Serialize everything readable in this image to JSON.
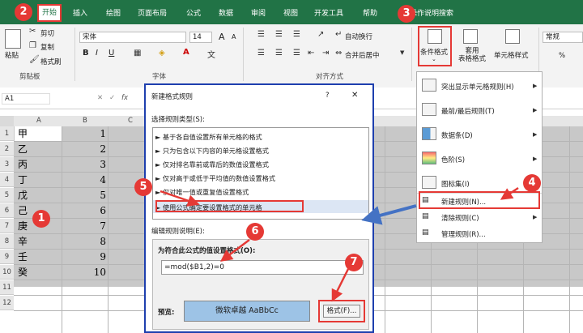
{
  "ribbon": {
    "tabs": [
      "插入",
      "绘图",
      "页面布局",
      "公式",
      "数据",
      "审阅",
      "视图",
      "开发工具",
      "帮助",
      "操作说明搜索"
    ],
    "home_tab": "开始",
    "clipboard": {
      "paste": "粘贴",
      "cut": "剪切",
      "copy": "复制",
      "format_painter": "格式刷",
      "label": "剪贴板"
    },
    "font": {
      "name": "宋体",
      "size": "14",
      "bold": "B",
      "italic": "I",
      "underline": "U",
      "grow": "A",
      "shrink": "A",
      "label": "字体"
    },
    "align": {
      "wrap": "自动换行",
      "merge": "合并后居中",
      "label": "对齐方式"
    },
    "cond_format": "条件格式",
    "table_format": "套用\n表格格式",
    "cell_style": "单元格样式",
    "number": {
      "format": "常规",
      "pct": "%"
    }
  },
  "formula_bar": {
    "name_box": "A1",
    "fx": "fx"
  },
  "grid": {
    "col_headers": [
      "A",
      "B",
      "C"
    ],
    "row_headers": [
      "1",
      "2",
      "3",
      "4",
      "5",
      "6",
      "7",
      "8",
      "9",
      "10",
      "11",
      "12"
    ],
    "col_a": [
      "甲",
      "乙",
      "丙",
      "丁",
      "戊",
      "己",
      "庚",
      "辛",
      "壬",
      "癸"
    ],
    "col_b": [
      "1",
      "2",
      "3",
      "4",
      "5",
      "6",
      "7",
      "8",
      "9",
      "10"
    ]
  },
  "dialog": {
    "title": "新建格式规则",
    "help": "?",
    "close": "✕",
    "select_type": "选择规则类型(S):",
    "rules": [
      "基于各自值设置所有单元格的格式",
      "只为包含以下内容的单元格设置格式",
      "仅对排名靠前或靠后的数值设置格式",
      "仅对高于或低于平均值的数值设置格式",
      "仅对唯一值或重复值设置格式",
      "使用公式确定要设置格式的单元格"
    ],
    "edit_desc": "编辑规则说明(E):",
    "formula_label": "为符合此公式的值设置格式(O):",
    "formula": "=mod($B1,2)=0",
    "preview_label": "预览:",
    "preview_text": "微软卓越  AaBbCc",
    "format_button": "格式(F)..."
  },
  "menu": {
    "items": [
      "突出显示单元格规则(H)",
      "最前/最后规则(T)",
      "数据条(D)",
      "色阶(S)",
      "图标集(I)",
      "新建规则(N)...",
      "清除规则(C)",
      "管理规则(R)..."
    ]
  },
  "badges": [
    "1",
    "2",
    "3",
    "4",
    "5",
    "6",
    "7"
  ],
  "colors": {
    "excel_green": "#217346",
    "accent_red": "#e53935",
    "dialog_border": "#1e3fae",
    "selection_gray": "#c8c8c8",
    "preview_blue": "#9dc3e6",
    "arrow_blue": "#4472c4"
  }
}
